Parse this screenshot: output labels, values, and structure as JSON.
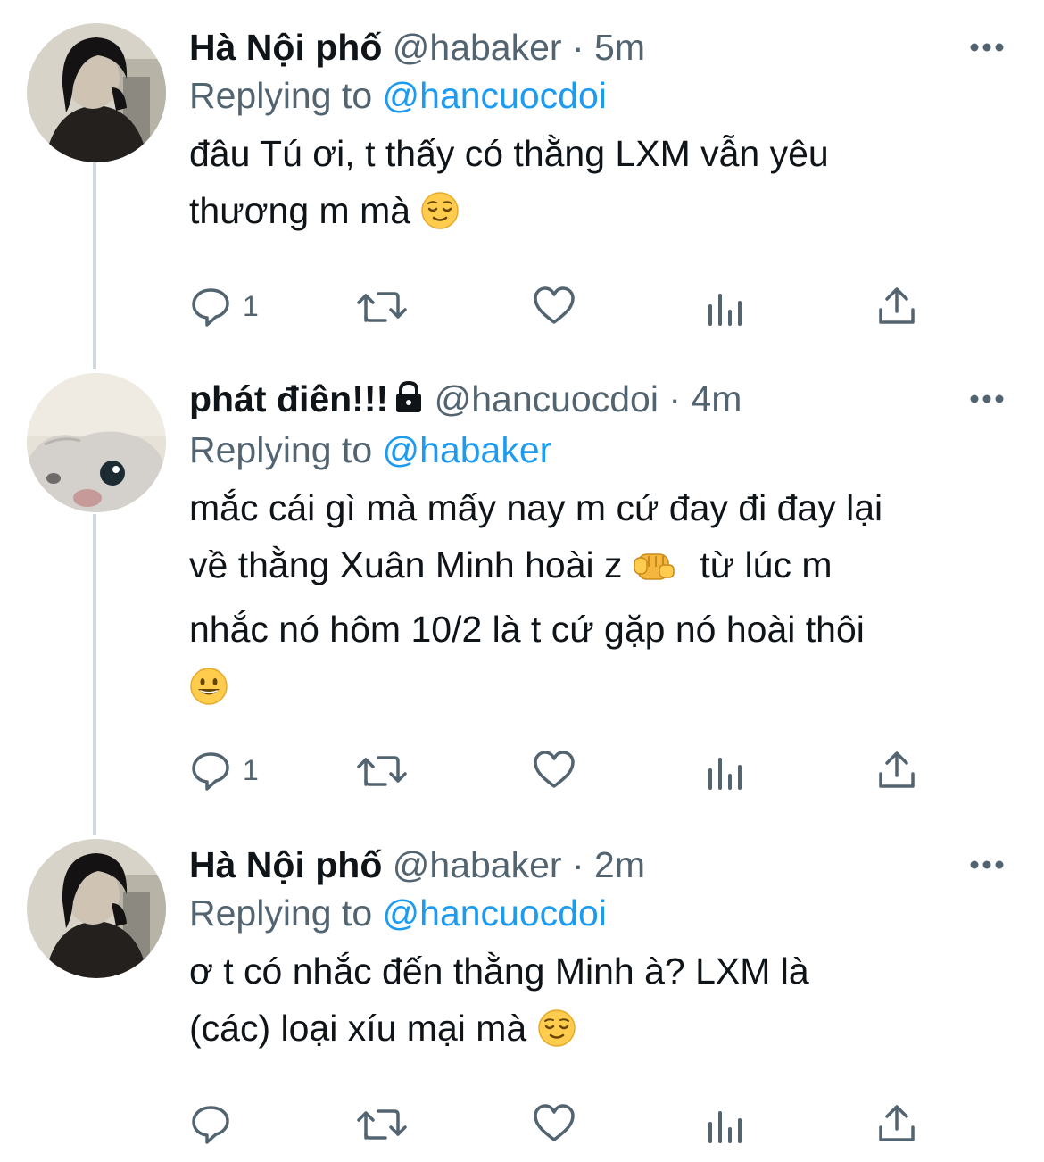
{
  "tweets": [
    {
      "name": "Hà Nội phố",
      "handle": "@habaker",
      "separator": "·",
      "time": "5m",
      "replying_prefix": "Replying to",
      "replying_to": "@hancuocdoi",
      "text_line1": "đâu Tú ơi, t thấy có thằng LXM vẫn yêu",
      "text_line2": "thương m mà",
      "reply_count": "1",
      "avatar": "person-photo-avatar",
      "locked": false
    },
    {
      "name": "phát điên!!!",
      "handle": "@hancuocdoi",
      "separator": "·",
      "time": "4m",
      "replying_prefix": "Replying to",
      "replying_to": "@habaker",
      "text_line1": "mắc cái gì mà mấy nay m cứ đay đi đay lại",
      "text_line2a": "về thằng Xuân Minh hoài z",
      "text_line2b": "từ lúc m",
      "text_line3": "nhắc nó hôm 10/2 là t cứ gặp nó hoài thôi",
      "reply_count": "1",
      "avatar": "cat-photo-avatar",
      "locked": true
    },
    {
      "name": "Hà Nội phố",
      "handle": "@habaker",
      "separator": "·",
      "time": "2m",
      "replying_prefix": "Replying to",
      "replying_to": "@hancuocdoi",
      "text_line1": "ơ t có nhắc đến thằng Minh à? LXM là",
      "text_line2": "(các) loại xíu mại mà",
      "reply_count": "",
      "avatar": "person-photo-avatar",
      "locked": false
    }
  ],
  "icons": {
    "reply": "reply-icon",
    "retweet": "retweet-icon",
    "like": "like-icon",
    "views": "views-icon",
    "share": "share-icon",
    "more": "more-icon"
  },
  "colors": {
    "text": "#0f1419",
    "secondary": "#536471",
    "mention": "#1d9bf0",
    "thread_line": "#cfd9de"
  }
}
